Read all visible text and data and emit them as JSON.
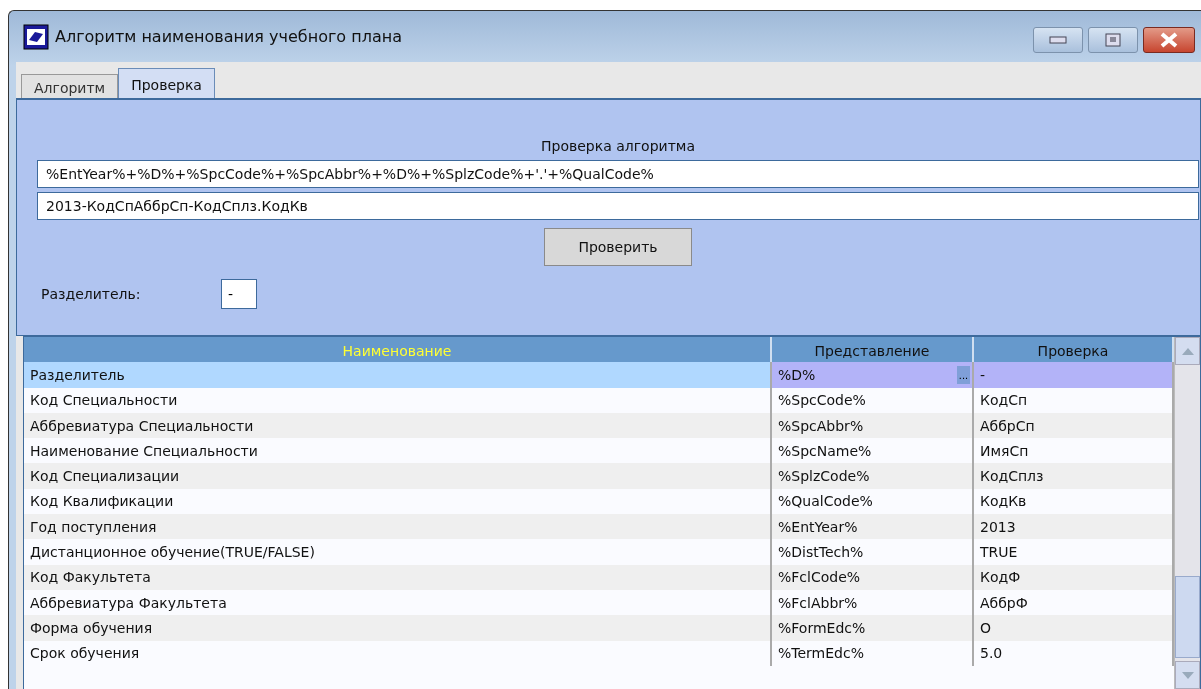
{
  "window": {
    "title": "Алгоритм наименования учебного плана"
  },
  "tabs": [
    {
      "label": "Алгоритм",
      "selected": false
    },
    {
      "label": "Проверка",
      "selected": true
    }
  ],
  "check_panel": {
    "heading": "Проверка алгоритма",
    "expression": "%EntYear%+%D%+%SpcCode%+%SpcAbbr%+%D%+%SplzCode%+'.'+%QualCode%",
    "result": "2013-КодСпАббрСп-КодСплз.КодКв",
    "button": "Проверить",
    "separator_label": "Разделитель:",
    "separator_value": "-"
  },
  "table": {
    "columns": [
      {
        "label": "Наименование",
        "sorted": true
      },
      {
        "label": "Представление",
        "sorted": false
      },
      {
        "label": "Проверка",
        "sorted": false
      }
    ],
    "rows": [
      {
        "cells": [
          "Разделитель",
          "%D%",
          "-"
        ],
        "selected": true,
        "ellipsis": "..."
      },
      {
        "cells": [
          "Код Специальности",
          "%SpcCode%",
          "КодСп"
        ],
        "selected": false
      },
      {
        "cells": [
          "Аббревиатура Специальности",
          "%SpcAbbr%",
          "АббрСп"
        ],
        "selected": false
      },
      {
        "cells": [
          "Наименование Специальности",
          "%SpcName%",
          "ИмяСп"
        ],
        "selected": false
      },
      {
        "cells": [
          "Код Специализации",
          "%SplzCode%",
          "КодСплз"
        ],
        "selected": false
      },
      {
        "cells": [
          "Код Квалификации",
          "%QualCode%",
          "КодКв"
        ],
        "selected": false
      },
      {
        "cells": [
          "Год поступления",
          "%EntYear%",
          "2013"
        ],
        "selected": false
      },
      {
        "cells": [
          "Дистанционное обучение(TRUE/FALSE)",
          "%DistTech%",
          "TRUE"
        ],
        "selected": false
      },
      {
        "cells": [
          "Код Факультета",
          "%FclCode%",
          "КодФ"
        ],
        "selected": false
      },
      {
        "cells": [
          "Аббревиатура Факультета",
          "%FclAbbr%",
          "АббрФ"
        ],
        "selected": false
      },
      {
        "cells": [
          "Форма обучения",
          "%FormEdc%",
          "О"
        ],
        "selected": false
      },
      {
        "cells": [
          "Срок обучения",
          "%TermEdc%",
          "5.0"
        ],
        "selected": false
      }
    ]
  }
}
